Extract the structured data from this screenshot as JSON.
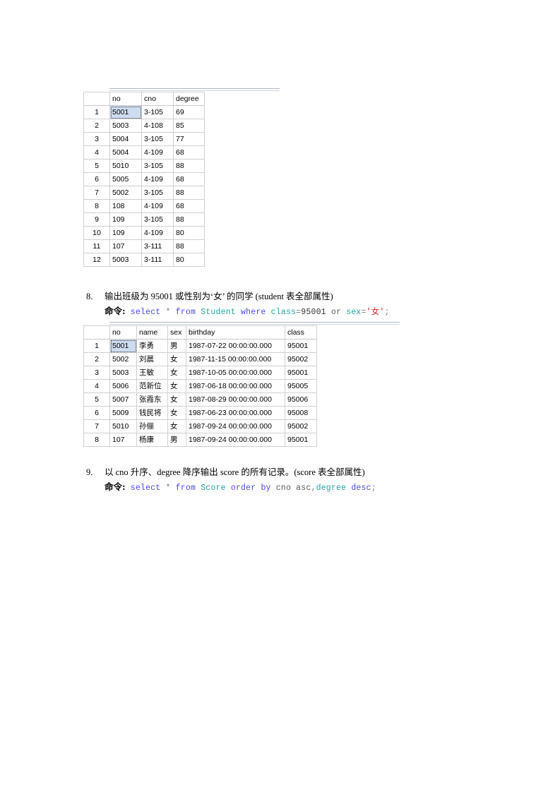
{
  "document": {
    "type": "sql-exercise-worksheet"
  },
  "score_table_top": {
    "caption": "score query result grid",
    "columns": [
      "",
      "no",
      "cno",
      "degree"
    ],
    "selected_cell": "5001",
    "rows": [
      [
        "1",
        "5001",
        "3-105",
        "69"
      ],
      [
        "2",
        "5003",
        "4-108",
        "85"
      ],
      [
        "3",
        "5004",
        "3-105",
        "77"
      ],
      [
        "4",
        "5004",
        "4-109",
        "68"
      ],
      [
        "5",
        "5010",
        "3-105",
        "88"
      ],
      [
        "6",
        "5005",
        "4-109",
        "68"
      ],
      [
        "7",
        "5002",
        "3-105",
        "88"
      ],
      [
        "8",
        "108",
        "4-109",
        "68"
      ],
      [
        "9",
        "109",
        "3-105",
        "88"
      ],
      [
        "10",
        "109",
        "4-109",
        "80"
      ],
      [
        "11",
        "107",
        "3-111",
        "88"
      ],
      [
        "12",
        "5003",
        "3-111",
        "80"
      ]
    ]
  },
  "question8": {
    "number": "8.",
    "text": "输出班级为 95001 或性别为‘女’  的同学 (student 表全部属性)",
    "command_label": "命令:",
    "sql_tokens": [
      {
        "t": "select",
        "c": "kw"
      },
      {
        "t": " ",
        "c": "plain"
      },
      {
        "t": "*",
        "c": "op"
      },
      {
        "t": " ",
        "c": "plain"
      },
      {
        "t": "from",
        "c": "kw"
      },
      {
        "t": " ",
        "c": "plain"
      },
      {
        "t": "Student",
        "c": "obj"
      },
      {
        "t": " ",
        "c": "plain"
      },
      {
        "t": "where",
        "c": "kw"
      },
      {
        "t": " ",
        "c": "plain"
      },
      {
        "t": "class",
        "c": "obj"
      },
      {
        "t": "=",
        "c": "op"
      },
      {
        "t": "95001",
        "c": "num"
      },
      {
        "t": " ",
        "c": "plain"
      },
      {
        "t": "or",
        "c": "plain"
      },
      {
        "t": " ",
        "c": "plain"
      },
      {
        "t": "sex",
        "c": "obj"
      },
      {
        "t": "=",
        "c": "op"
      },
      {
        "t": "'女'",
        "c": "str"
      },
      {
        "t": ";",
        "c": "punc"
      }
    ]
  },
  "student_table": {
    "caption": "student query result grid",
    "columns": [
      "",
      "no",
      "name",
      "sex",
      "birthday",
      "class"
    ],
    "selected_cell": "5001",
    "rows": [
      [
        "1",
        "5001",
        "李勇",
        "男",
        "1987-07-22 00:00:00.000",
        "95001"
      ],
      [
        "2",
        "5002",
        "刘晨",
        "女",
        "1987-11-15 00:00:00.000",
        "95002"
      ],
      [
        "3",
        "5003",
        "王敏",
        "女",
        "1987-10-05 00:00:00.000",
        "95001"
      ],
      [
        "4",
        "5006",
        "范新位",
        "女",
        "1987-06-18 00:00:00.000",
        "95005"
      ],
      [
        "5",
        "5007",
        "张霞东",
        "女",
        "1987-08-29 00:00:00.000",
        "95006"
      ],
      [
        "6",
        "5009",
        "钱民将",
        "女",
        "1987-06-23 00:00:00.000",
        "95008"
      ],
      [
        "7",
        "5010",
        "孙俪",
        "女",
        "1987-09-24 00:00:00.000",
        "95002"
      ],
      [
        "8",
        "107",
        "杨康",
        "男",
        "1987-09-24 00:00:00.000",
        "95001"
      ]
    ]
  },
  "question9": {
    "number": "9.",
    "text": "以 cno 升序、degree 降序输出 score 的所有记录。(score 表全部属性)",
    "command_label": "命令:",
    "sql_tokens": [
      {
        "t": "select",
        "c": "kw"
      },
      {
        "t": " ",
        "c": "plain"
      },
      {
        "t": "*",
        "c": "op"
      },
      {
        "t": " ",
        "c": "plain"
      },
      {
        "t": "from",
        "c": "kw"
      },
      {
        "t": " ",
        "c": "plain"
      },
      {
        "t": "Score",
        "c": "obj"
      },
      {
        "t": " ",
        "c": "plain"
      },
      {
        "t": "order",
        "c": "kw"
      },
      {
        "t": " ",
        "c": "plain"
      },
      {
        "t": "by",
        "c": "kw"
      },
      {
        "t": " ",
        "c": "plain"
      },
      {
        "t": "cno",
        "c": "plain"
      },
      {
        "t": " ",
        "c": "plain"
      },
      {
        "t": "asc",
        "c": "plain"
      },
      {
        "t": ",",
        "c": "punc"
      },
      {
        "t": "degree",
        "c": "obj"
      },
      {
        "t": " ",
        "c": "plain"
      },
      {
        "t": "desc",
        "c": "kw"
      },
      {
        "t": ";",
        "c": "punc"
      }
    ]
  },
  "colors": {
    "keyword": "#4a4ae0",
    "object": "#22a3a3",
    "string": "#d42020",
    "selection": "#cddcf0",
    "grid_border": "#d0d0d0"
  }
}
